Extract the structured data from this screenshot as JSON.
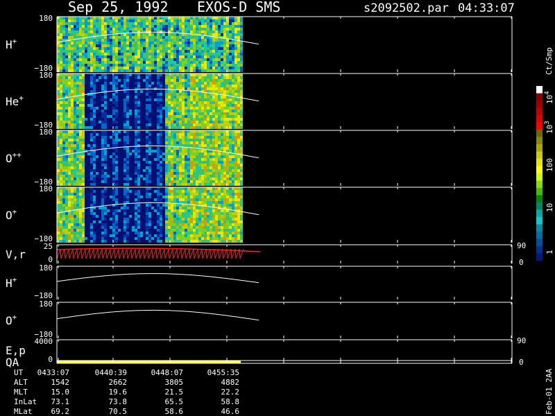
{
  "header": {
    "date": "Sep 25, 1992",
    "instrument": "EXOS-D SMS",
    "file": "s2092502.par",
    "time": "04:33:07"
  },
  "chart_data": {
    "type": "heatmap",
    "panels": [
      {
        "id": "h",
        "label": "H",
        "sup": "+",
        "ytop": "180",
        "ybot": "−180",
        "kind": "spectrogram",
        "bg": 0.85
      },
      {
        "id": "he",
        "label": "He",
        "sup": "+",
        "ytop": "180",
        "ybot": "−180",
        "kind": "spectrogram",
        "bg": 0.0
      },
      {
        "id": "opp",
        "label": "O",
        "sup": "++",
        "ytop": "180",
        "ybot": "−180",
        "kind": "spectrogram",
        "bg": 0.25
      },
      {
        "id": "op",
        "label": "O",
        "sup": "+",
        "ytop": "180",
        "ybot": "−180",
        "kind": "spectrogram",
        "bg": 0.2
      },
      {
        "id": "vr",
        "label": "V,r",
        "sup": "",
        "ytop": "25",
        "ybot": "0",
        "rtop": "90",
        "rbot": "0",
        "kind": "vr"
      },
      {
        "id": "h2",
        "label": "H",
        "sup": "+",
        "ytop": "180",
        "ybot": "−180",
        "kind": "line"
      },
      {
        "id": "o2",
        "label": "O",
        "sup": "+",
        "ytop": "180",
        "ybot": "−180",
        "kind": "line"
      },
      {
        "id": "ep",
        "label": "E,p",
        "sup": "",
        "ytop": "4000",
        "ybot": "",
        "rtop": "90",
        "rbot": "",
        "kind": "empty"
      },
      {
        "id": "qa",
        "label": "QA",
        "sup": "",
        "ytop": "",
        "ybot": "0",
        "rtop": "",
        "rbot": "0",
        "kind": "qa"
      }
    ],
    "time_ticks": [
      "0433:07",
      "0440:39",
      "0448:07",
      "0455:35"
    ],
    "orbit_rows": [
      {
        "label": "UT",
        "values": [
          "0433:07",
          "0440:39",
          "0448:07",
          "0455:35"
        ]
      },
      {
        "label": "ALT",
        "values": [
          "1542",
          "2662",
          "3805",
          "4882"
        ]
      },
      {
        "label": "MLT",
        "values": [
          "15.0",
          "19.6",
          "21.5",
          "22.2"
        ]
      },
      {
        "label": "InLat",
        "values": [
          "73.1",
          "73.8",
          "65.5",
          "58.8"
        ]
      },
      {
        "label": "MLat",
        "values": [
          "69.2",
          "70.5",
          "58.6",
          "46.6"
        ]
      }
    ],
    "colorbar": {
      "unit": "Ct/Smp",
      "labels": [
        {
          "base": "10",
          "exp": "4"
        },
        {
          "base": "10",
          "exp": "3"
        },
        {
          "base": "100",
          "exp": ""
        },
        {
          "base": "10",
          "exp": ""
        },
        {
          "base": "1",
          "exp": ""
        }
      ],
      "colors": [
        "#ffffff",
        "#8b0000",
        "#a00000",
        "#c00000",
        "#e00000",
        "#ff0000",
        "#6b6b00",
        "#8a8a00",
        "#a8a800",
        "#cccc00",
        "#e6e600",
        "#ffff00",
        "#ccff00",
        "#88dd00",
        "#44bb00",
        "#008800",
        "#008866",
        "#00aaaa",
        "#00cccc",
        "#008ba0",
        "#0070a0",
        "#0050a0",
        "#003090",
        "#001880"
      ],
      "palette": [
        "#001070",
        "#0030a0",
        "#0066cc",
        "#00a0d0",
        "#20c8a0",
        "#40c060",
        "#80d020",
        "#c0d000",
        "#e8e800",
        "#d0a000"
      ]
    },
    "footer_right": "Feb-01 2AA"
  }
}
